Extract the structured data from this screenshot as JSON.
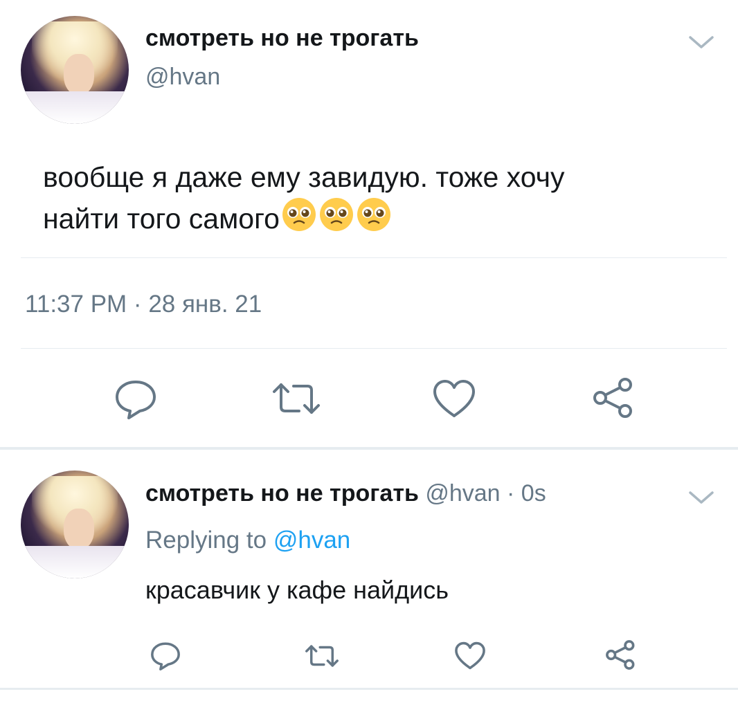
{
  "main_tweet": {
    "display_name": "смотреть но не трогать",
    "handle": "@hvan",
    "text_line1": "вообще я даже ему завидую. тоже хочу",
    "text_line2": "найти того самого",
    "emoji_name": "pleading-face-emoji",
    "timestamp": "11:37 PM · 28 янв. 21"
  },
  "reply_tweet": {
    "display_name": "смотреть но не трогать",
    "handle_time": "@hvan · 0s",
    "replying_prefix": "Replying to ",
    "replying_handle": "@hvan",
    "text": "красавчик у кафе найдись"
  },
  "action_icons": [
    "reply-icon",
    "retweet-icon",
    "like-icon",
    "share-icon"
  ],
  "colors": {
    "text": "#14171a",
    "muted": "#657786",
    "link": "#1da1f2",
    "divider": "#e6ecf0"
  }
}
